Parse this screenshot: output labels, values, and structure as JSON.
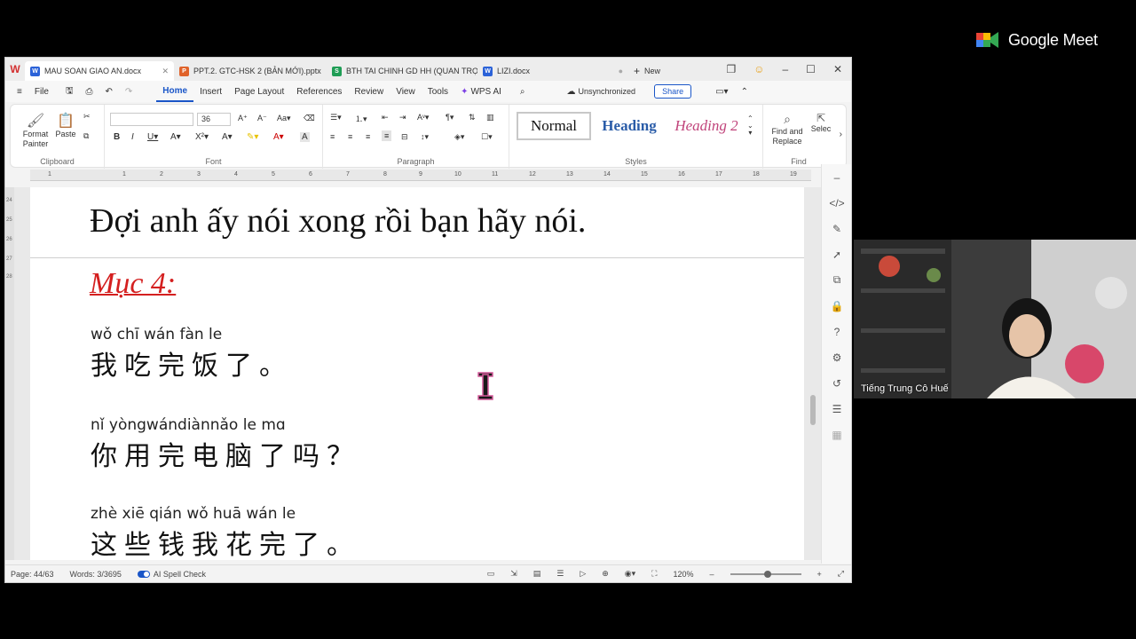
{
  "meet": {
    "brand": "Google Meet",
    "participant_name": "Tiếng Trung Cô Huế",
    "colors": {
      "green": "#34a853",
      "blue": "#4285f4",
      "yellow": "#fbbc04",
      "red": "#ea4335"
    }
  },
  "tabs": [
    {
      "icon": "W",
      "icon_color": "#2b62d8",
      "label": "MAU SOAN GIAO AN.docx",
      "active": true
    },
    {
      "icon": "P",
      "icon_color": "#e0632a",
      "label": "PPT.2. GTC-HSK 2 (BẢN MỚI).pptx",
      "active": false
    },
    {
      "icon": "S",
      "icon_color": "#1f9d55",
      "label": "BTH TAI CHINH GD HH (QUAN TRỌN",
      "active": false
    },
    {
      "icon": "W",
      "icon_color": "#2b62d8",
      "label": "LIZI.docx",
      "active": false
    }
  ],
  "new_tab_label": "New",
  "menu": {
    "file": "File",
    "items": [
      "Home",
      "Insert",
      "Page Layout",
      "References",
      "Review",
      "View",
      "Tools"
    ],
    "active": "Home",
    "wps_ai": "WPS AI",
    "sync_status": "Unsynchronized",
    "share": "Share"
  },
  "ribbon": {
    "clipboard": {
      "label": "Clipboard",
      "format_painter": "Format Painter",
      "paste": "Paste"
    },
    "font": {
      "label": "Font",
      "font_name": "",
      "font_size": "36"
    },
    "paragraph": {
      "label": "Paragraph"
    },
    "styles": {
      "label": "Styles",
      "normal": "Normal",
      "heading1": "Heading",
      "heading2": "Heading 2"
    },
    "find": {
      "label": "Find",
      "find_replace": "Find and Replace",
      "select": "Selec"
    }
  },
  "ruler_ticks": [
    "1",
    "1",
    "2",
    "3",
    "4",
    "5",
    "6",
    "7",
    "8",
    "9",
    "10",
    "11",
    "12",
    "13",
    "14",
    "15",
    "16",
    "17",
    "18",
    "19"
  ],
  "vruler_ticks": [
    "24",
    "25",
    "26",
    "27",
    "28"
  ],
  "document": {
    "vn_sentence": "Đợi anh ấy nói xong rồi bạn hãy nói.",
    "heading": "Mục 4:",
    "examples": [
      {
        "pinyin": "wǒ  chī  wán  fàn    le",
        "hanzi": "我吃完饭了。"
      },
      {
        "pinyin": "nǐ   yòngwándiànnǎo   le   mɑ",
        "hanzi": "你用完电脑了吗？"
      },
      {
        "pinyin": "zhè  xiē  qián  wǒ  huā  wán   le",
        "hanzi": "这些钱我花完了。"
      }
    ]
  },
  "status": {
    "page": "Page: 44/63",
    "words": "Words: 3/3695",
    "spell": "AI Spell Check",
    "zoom": "120%"
  }
}
